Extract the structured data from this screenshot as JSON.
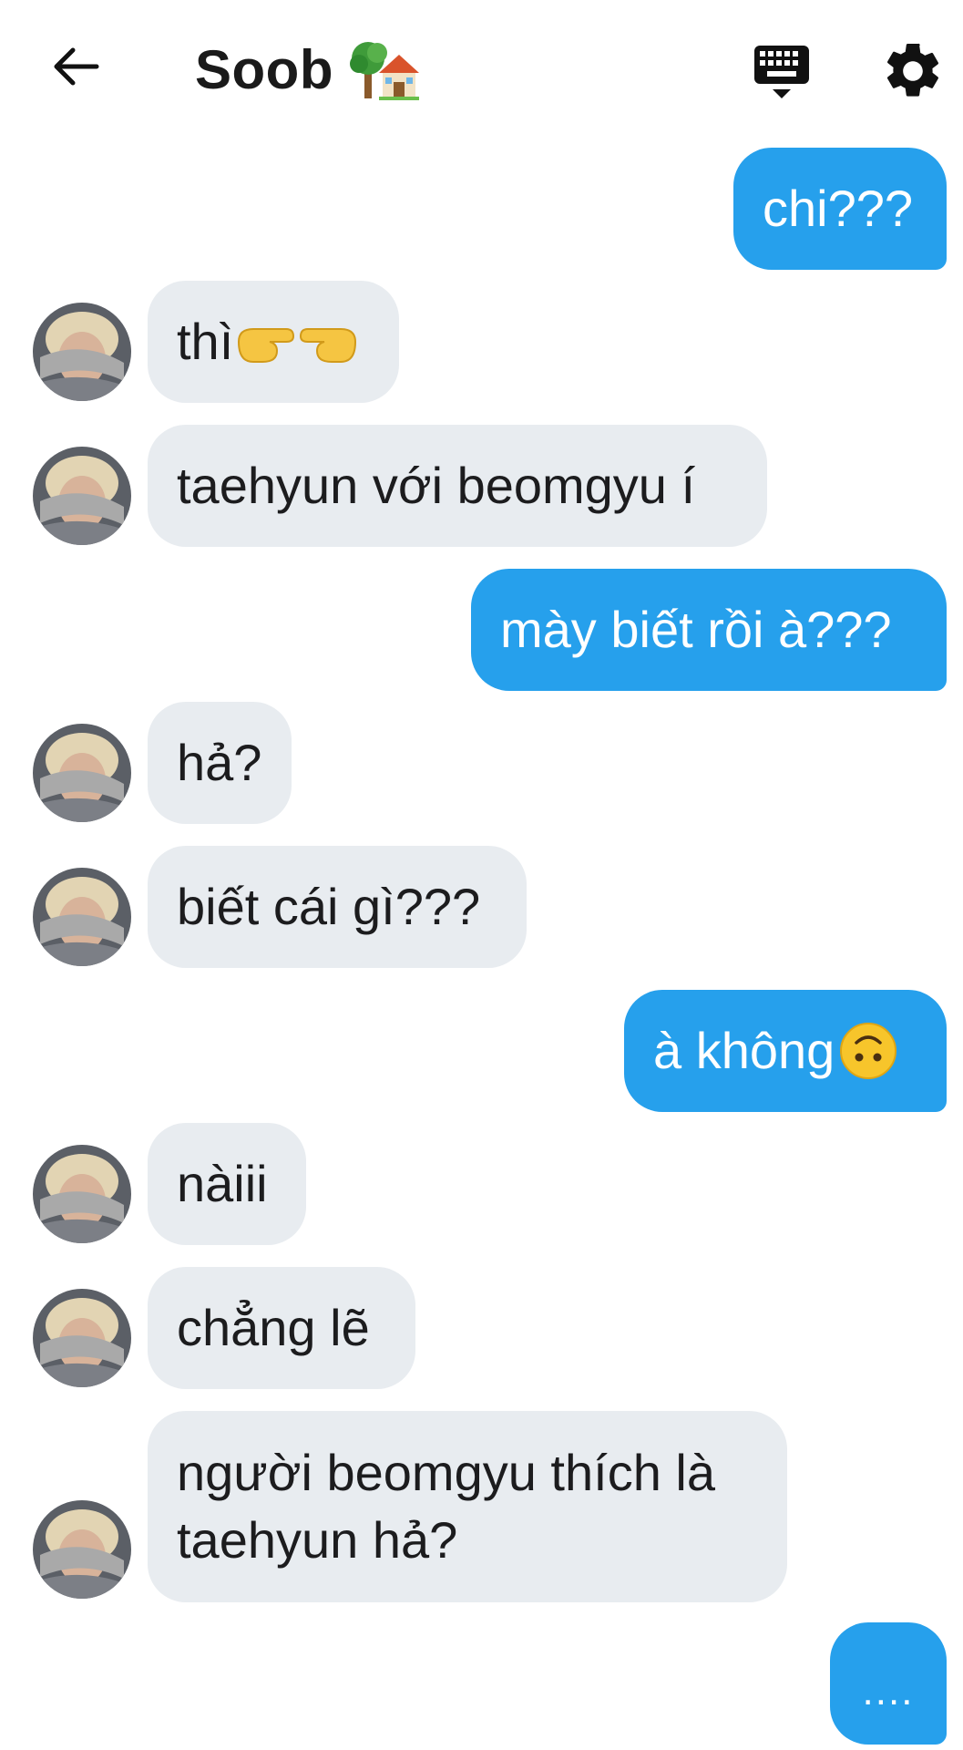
{
  "header": {
    "title": "Soob",
    "title_emoji": "tree-house-emoji",
    "back_icon": "arrow-left-icon",
    "keyboard_icon": "keyboard-icon",
    "settings_icon": "gear-icon"
  },
  "colors": {
    "outgoing_bubble": "#26a0ec",
    "incoming_bubble": "#e8ecf0",
    "background": "#ffffff"
  },
  "messages": [
    {
      "from": "me",
      "text": "chi???"
    },
    {
      "from": "them",
      "text": "thì",
      "emoji": "pointing-hands-emoji"
    },
    {
      "from": "them",
      "text": "taehyun với beomgyu í"
    },
    {
      "from": "me",
      "text": "mày biết rồi à???"
    },
    {
      "from": "them",
      "text": "hả?"
    },
    {
      "from": "them",
      "text": "biết cái gì???"
    },
    {
      "from": "me",
      "text": "à không",
      "emoji": "upside-down-face-emoji"
    },
    {
      "from": "them",
      "text": "nàiii"
    },
    {
      "from": "them",
      "text": "chẳng lẽ"
    },
    {
      "from": "them",
      "text": "người beomgyu thích là taehyun hả?"
    },
    {
      "from": "me",
      "text": "...."
    }
  ]
}
